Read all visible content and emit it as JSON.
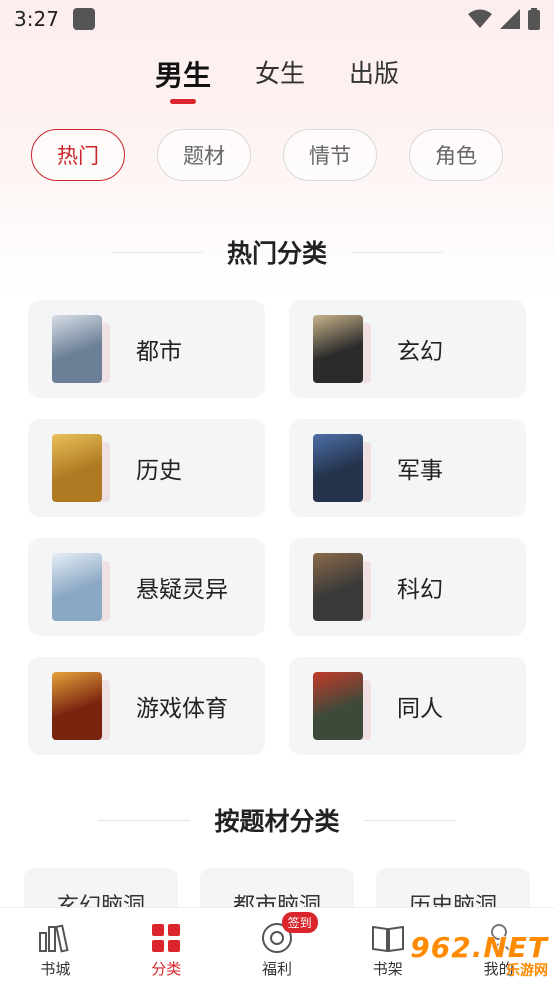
{
  "status_bar": {
    "time": "3:27"
  },
  "gender_tabs": [
    {
      "label": "男生",
      "active": true
    },
    {
      "label": "女生",
      "active": false
    },
    {
      "label": "出版",
      "active": false
    }
  ],
  "filter_chips": [
    {
      "label": "热门",
      "active": true
    },
    {
      "label": "题材",
      "active": false
    },
    {
      "label": "情节",
      "active": false
    },
    {
      "label": "角色",
      "active": false
    }
  ],
  "hot_section": {
    "title": "热门分类",
    "categories": [
      {
        "label": "都市",
        "cover_color": "#6b7f97",
        "cover_accent": "#d8dde6"
      },
      {
        "label": "玄幻",
        "cover_color": "#2b2b2b",
        "cover_accent": "#c9b48a"
      },
      {
        "label": "历史",
        "cover_color": "#b07a22",
        "cover_accent": "#e9c15a"
      },
      {
        "label": "军事",
        "cover_color": "#24324a",
        "cover_accent": "#4c6fa8"
      },
      {
        "label": "悬疑灵异",
        "cover_color": "#8aa7c4",
        "cover_accent": "#e6eef6"
      },
      {
        "label": "科幻",
        "cover_color": "#3a3a3a",
        "cover_accent": "#8b6a4a"
      },
      {
        "label": "游戏体育",
        "cover_color": "#7a2410",
        "cover_accent": "#e5a23a"
      },
      {
        "label": "同人",
        "cover_color": "#3d4a3a",
        "cover_accent": "#c43a2a"
      }
    ]
  },
  "theme_section": {
    "title": "按题材分类",
    "tags": [
      "玄幻脑洞",
      "都市脑洞",
      "历史脑洞"
    ]
  },
  "bottom_nav": {
    "items": [
      {
        "label": "书城",
        "icon": "books-icon",
        "active": false
      },
      {
        "label": "分类",
        "icon": "grid-icon",
        "active": true
      },
      {
        "label": "福利",
        "icon": "coin-icon",
        "active": false,
        "badge": "签到"
      },
      {
        "label": "书架",
        "icon": "open-book-icon",
        "active": false
      },
      {
        "label": "我的",
        "icon": "user-icon",
        "active": false
      }
    ]
  },
  "watermark": {
    "main": "962.NET",
    "sub": "乐游网"
  },
  "colors": {
    "accent": "#d9252b",
    "card_bg": "#f4f5f7",
    "watermark": "#ff8a00"
  }
}
